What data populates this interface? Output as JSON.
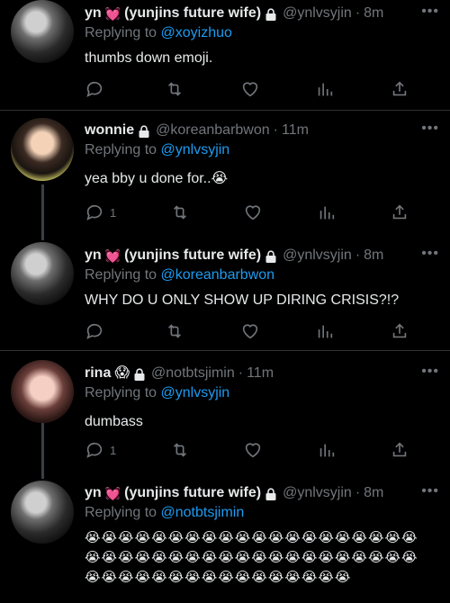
{
  "tweets": [
    {
      "display_name": "yn",
      "name_suffix": "(yunjins future wife)",
      "handle": "@ynlvsyjin",
      "time": "8m",
      "reply_prefix": "Replying to",
      "reply_to": "@xoyizhuo",
      "text": "thumbs down emoji.",
      "reply_count": ""
    },
    {
      "display_name": "wonnie",
      "name_suffix": "",
      "handle": "@koreanbarbwon",
      "time": "11m",
      "reply_prefix": "Replying to",
      "reply_to": "@ynlvsyjin",
      "text": "yea bby u done for..😭",
      "reply_count": "1"
    },
    {
      "display_name": "yn",
      "name_suffix": "(yunjins future wife)",
      "handle": "@ynlvsyjin",
      "time": "8m",
      "reply_prefix": "Replying to",
      "reply_to": "@koreanbarbwon",
      "text": "WHY DO U ONLY SHOW UP DIRING CRISIS?!?",
      "reply_count": ""
    },
    {
      "display_name": "rina",
      "name_suffix": "😱",
      "handle": "@notbtsjimin",
      "time": "11m",
      "reply_prefix": "Replying to",
      "reply_to": "@ynlvsyjin",
      "text": "dumbass",
      "reply_count": "1"
    },
    {
      "display_name": "yn",
      "name_suffix": "(yunjins future wife)",
      "handle": "@ynlvsyjin",
      "time": "8m",
      "reply_prefix": "Replying to",
      "reply_to": "@notbtsjimin",
      "emoji_lines": [
        "😭😭😭😭😭😭😭😭😭😭😭😭😭😭😭😭😭😭😭😭",
        "😭😭😭😭😭😭😭😭😭😭😭😭😭😭😭😭😭😭😭😭",
        "😭😭😭😭😭😭😭😭😭😭😭😭😭😭😭😭"
      ]
    }
  ],
  "icons": {
    "heart_badge": "heart-icon",
    "lock": "lock-icon",
    "more": "more-icon",
    "reply": "reply-icon",
    "retweet": "retweet-icon",
    "like": "like-icon",
    "analytics": "analytics-icon",
    "share": "share-icon"
  },
  "colors": {
    "background": "#000000",
    "link": "#1d9bf0",
    "muted": "#71767b",
    "heart": "#f91880",
    "divider": "#2f3336"
  },
  "more_glyph": "•••",
  "heart_glyph": "💓",
  "separator": "·"
}
